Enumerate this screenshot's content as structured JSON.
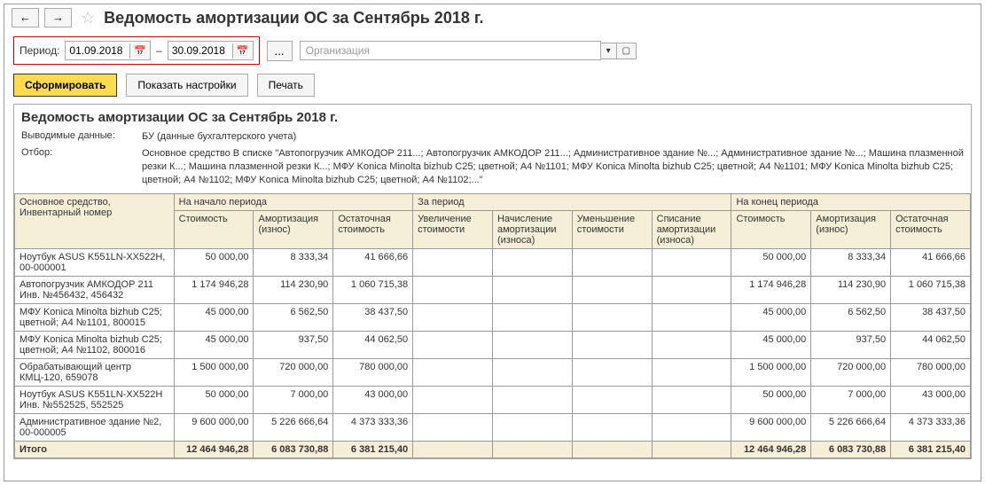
{
  "title": "Ведомость амортизации ОС за Сентябрь 2018 г.",
  "period": {
    "label": "Период:",
    "from": "01.09.2018",
    "to": "30.09.2018",
    "sep": "–"
  },
  "org_placeholder": "Организация",
  "toolbar": {
    "form": "Сформировать",
    "settings": "Показать настройки",
    "print": "Печать"
  },
  "report": {
    "title": "Ведомость амортизации ОС за Сентябрь 2018 г.",
    "data_label": "Выводимые данные:",
    "data_value": "БУ (данные бухгалтерского учета)",
    "filter_label": "Отбор:",
    "filter_value": "Основное средство В списке \"Автопогрузчик АМКОДОР 211...; Автопогрузчик АМКОДОР 211...; Административное здание №...; Административное здание №...; Машина плазменной резки К...; Машина плазменной резки К...; МФУ Konica Minolta bizhub C25; цветной;  A4  №1101; МФУ Konica Minolta bizhub C25; цветной;  A4  №1101; МФУ Konica Minolta bizhub C25; цветной;  A4  №1102; МФУ Konica Minolta bizhub C25; цветной;  A4  №1102;...\""
  },
  "headers": {
    "asset": "Основное средство, Инвентарный номер",
    "start": "На начало периода",
    "period": "За период",
    "end": "На конец периода",
    "cost": "Стоимость",
    "amort": "Амортизация (износ)",
    "residual": "Остаточная стоимость",
    "inc": "Увеличение стоимости",
    "accr": "Начисление амортизации (износа)",
    "dec": "Уменьшение стоимости",
    "writeoff": "Списание амортизации (износа)"
  },
  "rows": [
    {
      "name": "Ноутбук ASUS K551LN-XX522H, 00-000001",
      "s_cost": "50 000,00",
      "s_amort": "8 333,34",
      "s_res": "41 666,66",
      "inc": "",
      "accr": "",
      "dec": "",
      "wo": "",
      "e_cost": "50 000,00",
      "e_amort": "8 333,34",
      "e_res": "41 666,66"
    },
    {
      "name": "Автопогрузчик АМКОДОР 211 Инв. №456432, 456432",
      "s_cost": "1 174 946,28",
      "s_amort": "114 230,90",
      "s_res": "1 060 715,38",
      "inc": "",
      "accr": "",
      "dec": "",
      "wo": "",
      "e_cost": "1 174 946,28",
      "e_amort": "114 230,90",
      "e_res": "1 060 715,38"
    },
    {
      "name": "МФУ Konica Minolta bizhub C25; цветной;  A4  №1101, 800015",
      "s_cost": "45 000,00",
      "s_amort": "6 562,50",
      "s_res": "38 437,50",
      "inc": "",
      "accr": "",
      "dec": "",
      "wo": "",
      "e_cost": "45 000,00",
      "e_amort": "6 562,50",
      "e_res": "38 437,50"
    },
    {
      "name": "МФУ Konica Minolta bizhub C25; цветной;  A4  №1102, 800016",
      "s_cost": "45 000,00",
      "s_amort": "937,50",
      "s_res": "44 062,50",
      "inc": "",
      "accr": "",
      "dec": "",
      "wo": "",
      "e_cost": "45 000,00",
      "e_amort": "937,50",
      "e_res": "44 062,50"
    },
    {
      "name": "Обрабатывающий центр КМЦ-120, 659078",
      "s_cost": "1 500 000,00",
      "s_amort": "720 000,00",
      "s_res": "780 000,00",
      "inc": "",
      "accr": "",
      "dec": "",
      "wo": "",
      "e_cost": "1 500 000,00",
      "e_amort": "720 000,00",
      "e_res": "780 000,00"
    },
    {
      "name": "Ноутбук ASUS K551LN-XX522H Инв. №552525, 552525",
      "s_cost": "50 000,00",
      "s_amort": "7 000,00",
      "s_res": "43 000,00",
      "inc": "",
      "accr": "",
      "dec": "",
      "wo": "",
      "e_cost": "50 000,00",
      "e_amort": "7 000,00",
      "e_res": "43 000,00"
    },
    {
      "name": "Административное здание №2, 00-000005",
      "s_cost": "9 600 000,00",
      "s_amort": "5 226 666,64",
      "s_res": "4 373 333,36",
      "inc": "",
      "accr": "",
      "dec": "",
      "wo": "",
      "e_cost": "9 600 000,00",
      "e_amort": "5 226 666,64",
      "e_res": "4 373 333,36"
    }
  ],
  "total": {
    "label": "Итого",
    "s_cost": "12 464 946,28",
    "s_amort": "6 083 730,88",
    "s_res": "6 381 215,40",
    "inc": "",
    "accr": "",
    "dec": "",
    "wo": "",
    "e_cost": "12 464 946,28",
    "e_amort": "6 083 730,88",
    "e_res": "6 381 215,40"
  }
}
